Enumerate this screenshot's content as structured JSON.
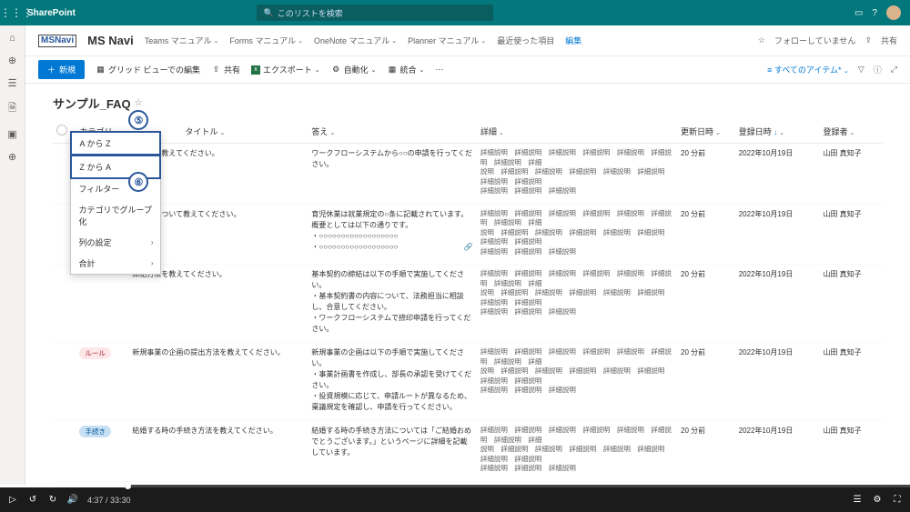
{
  "suite": {
    "app": "SharePoint",
    "search_placeholder": "このリストを検索"
  },
  "site": {
    "logo_text": "MSNavi",
    "name": "MS Navi",
    "nav": [
      {
        "label": "Teams マニュアル"
      },
      {
        "label": "Forms マニュアル"
      },
      {
        "label": "OneNote マニュアル"
      },
      {
        "label": "Planner マニュアル"
      },
      {
        "label": "最近使った項目"
      }
    ],
    "edit": "編集",
    "follow": "フォローしていません",
    "share": "共有"
  },
  "cmd": {
    "new": "新規",
    "grid": "グリッド ビューでの編集",
    "share": "共有",
    "export": "エクスポート",
    "automate": "自動化",
    "integrate": "統合",
    "view": "すべてのアイテム"
  },
  "list": {
    "title": "サンプル_FAQ"
  },
  "columns": {
    "category": "カテゴリ",
    "title": "タイトル",
    "answer": "答え",
    "detail": "詳細",
    "updated": "更新日時",
    "registered": "登録日時",
    "author": "登録者"
  },
  "filter_menu": {
    "az": "A から Z",
    "za": "Z から A",
    "filter": "フィルター",
    "group": "カテゴリでグループ化",
    "col_settings": "列の設定",
    "total": "合計"
  },
  "callouts": {
    "five": "⑤",
    "six": "⑥"
  },
  "rows": [
    {
      "category": "",
      "title": "き方法を教えてください。",
      "answer": "ワークフローシステムから○○の申請を行ってください。",
      "detail": "詳細説明　詳細説明　詳細説明　詳細説明　詳細説明　詳細説明　詳細説明　詳細\n説明　詳細説明　詳細説明　詳細説明　詳細説明　詳細説明　詳細説明　詳細説明\n詳細説明　詳細説明　詳細説明",
      "updated": "20 分前",
      "registered": "2022年10月19日",
      "author": "山田 真知子"
    },
    {
      "category": "",
      "title": "の制度について教えてください。",
      "answer": "育児休業は就業規定の○条に記載されています。\n概要としては以下の通りです。\n・○○○○○○○○○○○○○○○○○○\n・○○○○○○○○○○○○○○○○○○",
      "detail": "詳細説明　詳細説明　詳細説明　詳細説明　詳細説明　詳細説明　詳細説明　詳細\n説明　詳細説明　詳細説明　詳細説明　詳細説明　詳細説明　詳細説明　詳細説明\n詳細説明　詳細説明　詳細説明",
      "updated": "20 分前",
      "registered": "2022年10月19日",
      "author": "山田 真知子",
      "has_link": true
    },
    {
      "category": "",
      "title": "締結方法を教えてください。",
      "answer": "基本契約の締結は以下の手順で実施してください。\n・基本契約書の内容について、法務担当に相談し、合意してください。\n・ワークフローシステムで捺印申請を行ってください。",
      "detail": "詳細説明　詳細説明　詳細説明　詳細説明　詳細説明　詳細説明　詳細説明　詳細\n説明　詳細説明　詳細説明　詳細説明　詳細説明　詳細説明　詳細説明　詳細説明\n詳細説明　詳細説明　詳細説明",
      "updated": "20 分前",
      "registered": "2022年10月19日",
      "author": "山田 真知子"
    },
    {
      "category": "ルール",
      "cat_class": "tag-pink",
      "title": "新規事業の企画の提出方法を教えてください。",
      "answer": "新規事業の企画は以下の手順で実施してください。\n・事業計画書を作成し、部長の承認を受けてください。\n・投資規模に応じて、申請ルートが異なるため、稟議規定を確認し、申請を行ってください。",
      "detail": "詳細説明　詳細説明　詳細説明　詳細説明　詳細説明　詳細説明　詳細説明　詳細\n説明　詳細説明　詳細説明　詳細説明　詳細説明　詳細説明　詳細説明　詳細説明\n詳細説明　詳細説明　詳細説明",
      "updated": "20 分前",
      "registered": "2022年10月19日",
      "author": "山田 真知子"
    },
    {
      "category": "手続き",
      "cat_class": "tag-teal",
      "title": "結婚する時の手続き方法を教えてください。",
      "answer": "結婚する時の手続き方法については「ご結婚おめでとうございます。」というページに詳細を記載しています。",
      "detail": "詳細説明　詳細説明　詳細説明　詳細説明　詳細説明　詳細説明　詳細説明　詳細\n説明　詳細説明　詳細説明　詳細説明　詳細説明　詳細説明　詳細説明　詳細説明\n詳細説明　詳細説明　詳細説明",
      "updated": "20 分前",
      "registered": "2022年10月19日",
      "author": "山田 真知子"
    }
  ],
  "video": {
    "time": "4:37 / 33:30"
  }
}
